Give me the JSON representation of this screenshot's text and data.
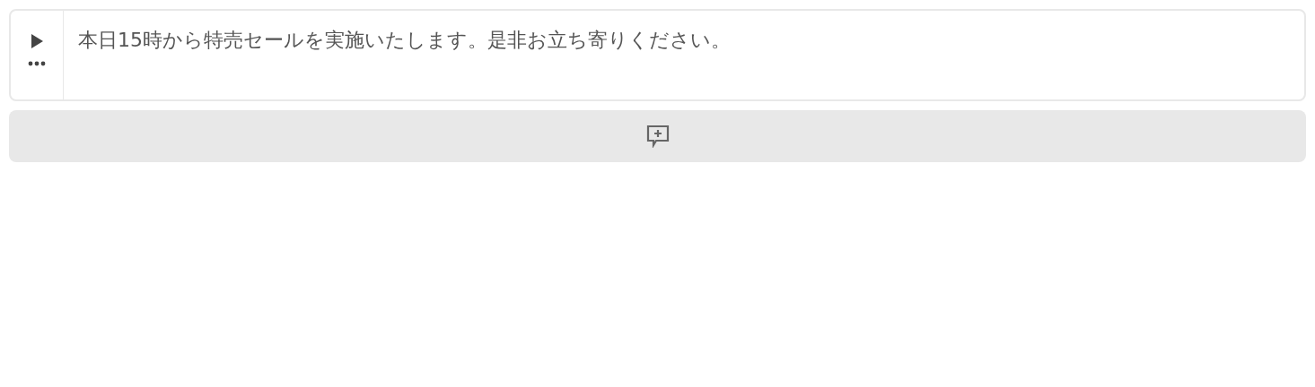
{
  "message": {
    "text": "本日15時から特売セールを実施いたします。是非お立ち寄りください。"
  }
}
